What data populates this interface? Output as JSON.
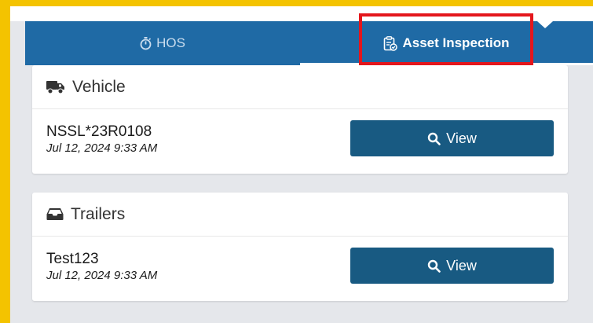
{
  "tabs": {
    "hos_label": "HOS",
    "asset_label": "Asset Inspection",
    "hos_icon": "stopwatch-icon",
    "asset_icon": "clipboard-check-icon"
  },
  "vehicle": {
    "title": "Vehicle",
    "icon": "truck-icon",
    "id": "NSSL*23R0108",
    "date": "Jul 12, 2024 9:33 AM",
    "button_label": "View"
  },
  "trailers": {
    "title": "Trailers",
    "icon": "inbox-icon",
    "id": "Test123",
    "date": "Jul 12, 2024 9:33 AM",
    "button_label": "View"
  },
  "colors": {
    "tabbar": "#1f6aa5",
    "button": "#185a82",
    "frame": "#f4c300",
    "highlight": "#e4161c"
  }
}
